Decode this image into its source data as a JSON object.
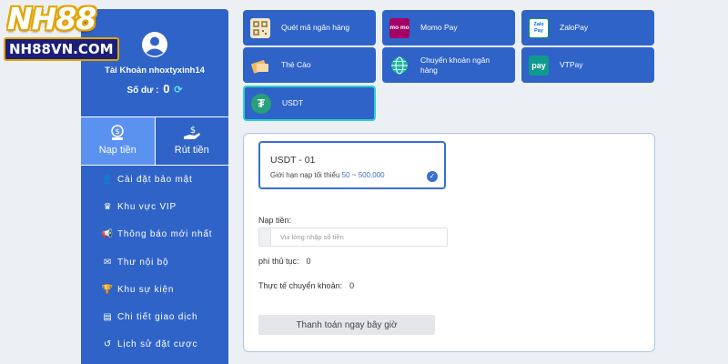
{
  "logo": {
    "title": "NH88",
    "subtitle": "NH88VN.COM"
  },
  "user": {
    "account_label": "Tài Khoản nhoxtyxinh14",
    "balance_label": "Số dư :",
    "balance_value": "0"
  },
  "actions": {
    "deposit": "Nạp tiền",
    "withdraw": "Rút tiền"
  },
  "menu": [
    {
      "icon": "user-shield-icon",
      "label": "Cài đặt bảo mật"
    },
    {
      "icon": "crown-icon",
      "label": "Khu vực VIP"
    },
    {
      "icon": "megaphone-icon",
      "label": "Thông báo mới nhất"
    },
    {
      "icon": "envelope-icon",
      "label": "Thư nội bộ"
    },
    {
      "icon": "trophy-icon",
      "label": "Khu sự kiện"
    },
    {
      "icon": "receipt-icon",
      "label": "Chi tiết giao dịch"
    },
    {
      "icon": "history-icon",
      "label": "Lịch sử đặt cược"
    }
  ],
  "payment_methods": [
    {
      "label": "Quét mã ngân hàng",
      "icon": "qr-code-icon"
    },
    {
      "label": "Momo Pay",
      "icon": "momo-icon",
      "icon_text": "mo mo"
    },
    {
      "label": "ZaloPay",
      "icon": "zalopay-icon",
      "icon_text": "Zalo Pay"
    },
    {
      "label": "Thẻ Cào",
      "icon": "scratch-card-icon"
    },
    {
      "label": "Chuyển khoản ngân hàng",
      "icon": "globe-icon"
    },
    {
      "label": "VTPay",
      "icon": "vtpay-icon",
      "icon_text": "pay"
    },
    {
      "label": "USDT",
      "icon": "tether-icon",
      "icon_text": "₮"
    }
  ],
  "channel": {
    "title": "USDT - 01",
    "limit_label": "Giới hạn nạp tối thiểu",
    "min": "50",
    "sep": "~",
    "max": "500,000"
  },
  "form": {
    "amount_label": "Nạp tiền:",
    "amount_placeholder": "Vui lòng nhập số tiền",
    "fee_label": "phí thủ tục:",
    "fee_value": "0",
    "actual_label": "Thực tế chuyển khoản:",
    "actual_value": "0",
    "pay_button": "Thanh toán ngay bây giờ"
  },
  "colors": {
    "primary": "#2f63c8",
    "active_tab": "#5b92f0",
    "selected_border": "#2fd1ce",
    "highlight": "#3a6fd0"
  }
}
